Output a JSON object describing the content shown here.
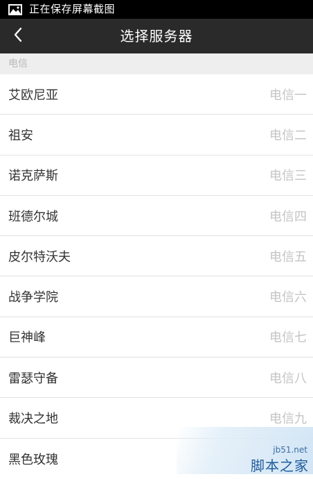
{
  "status_bar": {
    "text": "正在保存屏幕截图",
    "icon": "image-icon"
  },
  "header": {
    "title": "选择服务器",
    "back_icon": "chevron-left-icon"
  },
  "section": {
    "label": "电信"
  },
  "servers": [
    {
      "name": "艾欧尼亚",
      "isp": "电信一"
    },
    {
      "name": "祖安",
      "isp": "电信二"
    },
    {
      "name": "诺克萨斯",
      "isp": "电信三"
    },
    {
      "name": "班德尔城",
      "isp": "电信四"
    },
    {
      "name": "皮尔特沃夫",
      "isp": "电信五"
    },
    {
      "name": "战争学院",
      "isp": "电信六"
    },
    {
      "name": "巨神峰",
      "isp": "电信七"
    },
    {
      "name": "雷瑟守备",
      "isp": "电信八"
    },
    {
      "name": "裁决之地",
      "isp": "电信九"
    },
    {
      "name": "黑色玫瑰",
      "isp": ""
    }
  ],
  "watermark": {
    "url": "jb51.net",
    "name": "脚本之家"
  },
  "colors": {
    "status_bar_bg": "#000000",
    "title_bar_bg": "#2a2a2b",
    "section_bg": "#eeeeee",
    "secondary_text": "#c4c4c4"
  }
}
